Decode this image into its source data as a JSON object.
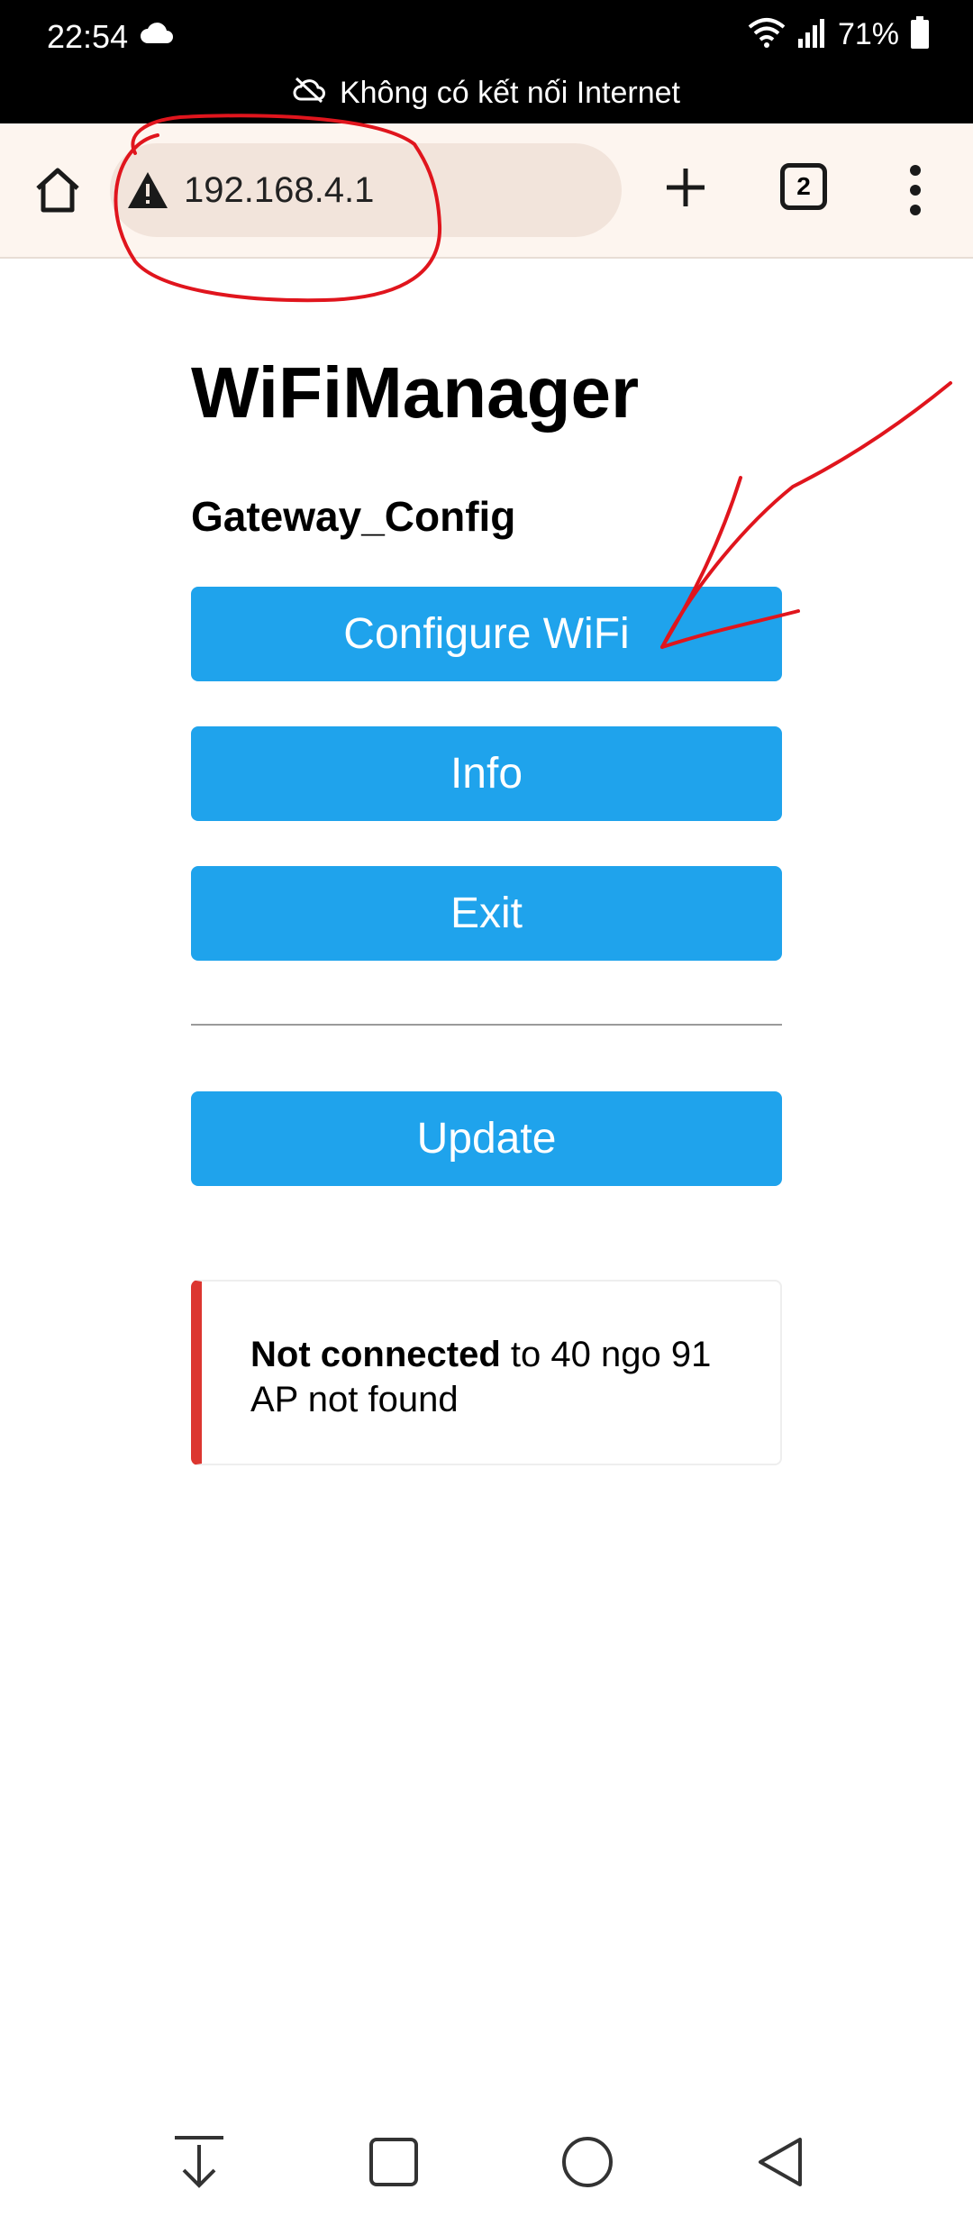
{
  "status_bar": {
    "time": "22:54",
    "battery": "71%",
    "offline_message": "Không có kết nối Internet"
  },
  "browser": {
    "url": "192.168.4.1",
    "tab_count": "2"
  },
  "page": {
    "title": "WiFiManager",
    "subtitle": "Gateway_Config",
    "buttons": {
      "configure": "Configure WiFi",
      "info": "Info",
      "exit": "Exit",
      "update": "Update"
    },
    "message": {
      "bold": "Not connected",
      "rest": " to 40 ngo 91",
      "line2": "AP not found"
    }
  },
  "colors": {
    "button": "#1fa3ec",
    "alert_border": "#dc3630",
    "annotation": "#e0151d"
  }
}
